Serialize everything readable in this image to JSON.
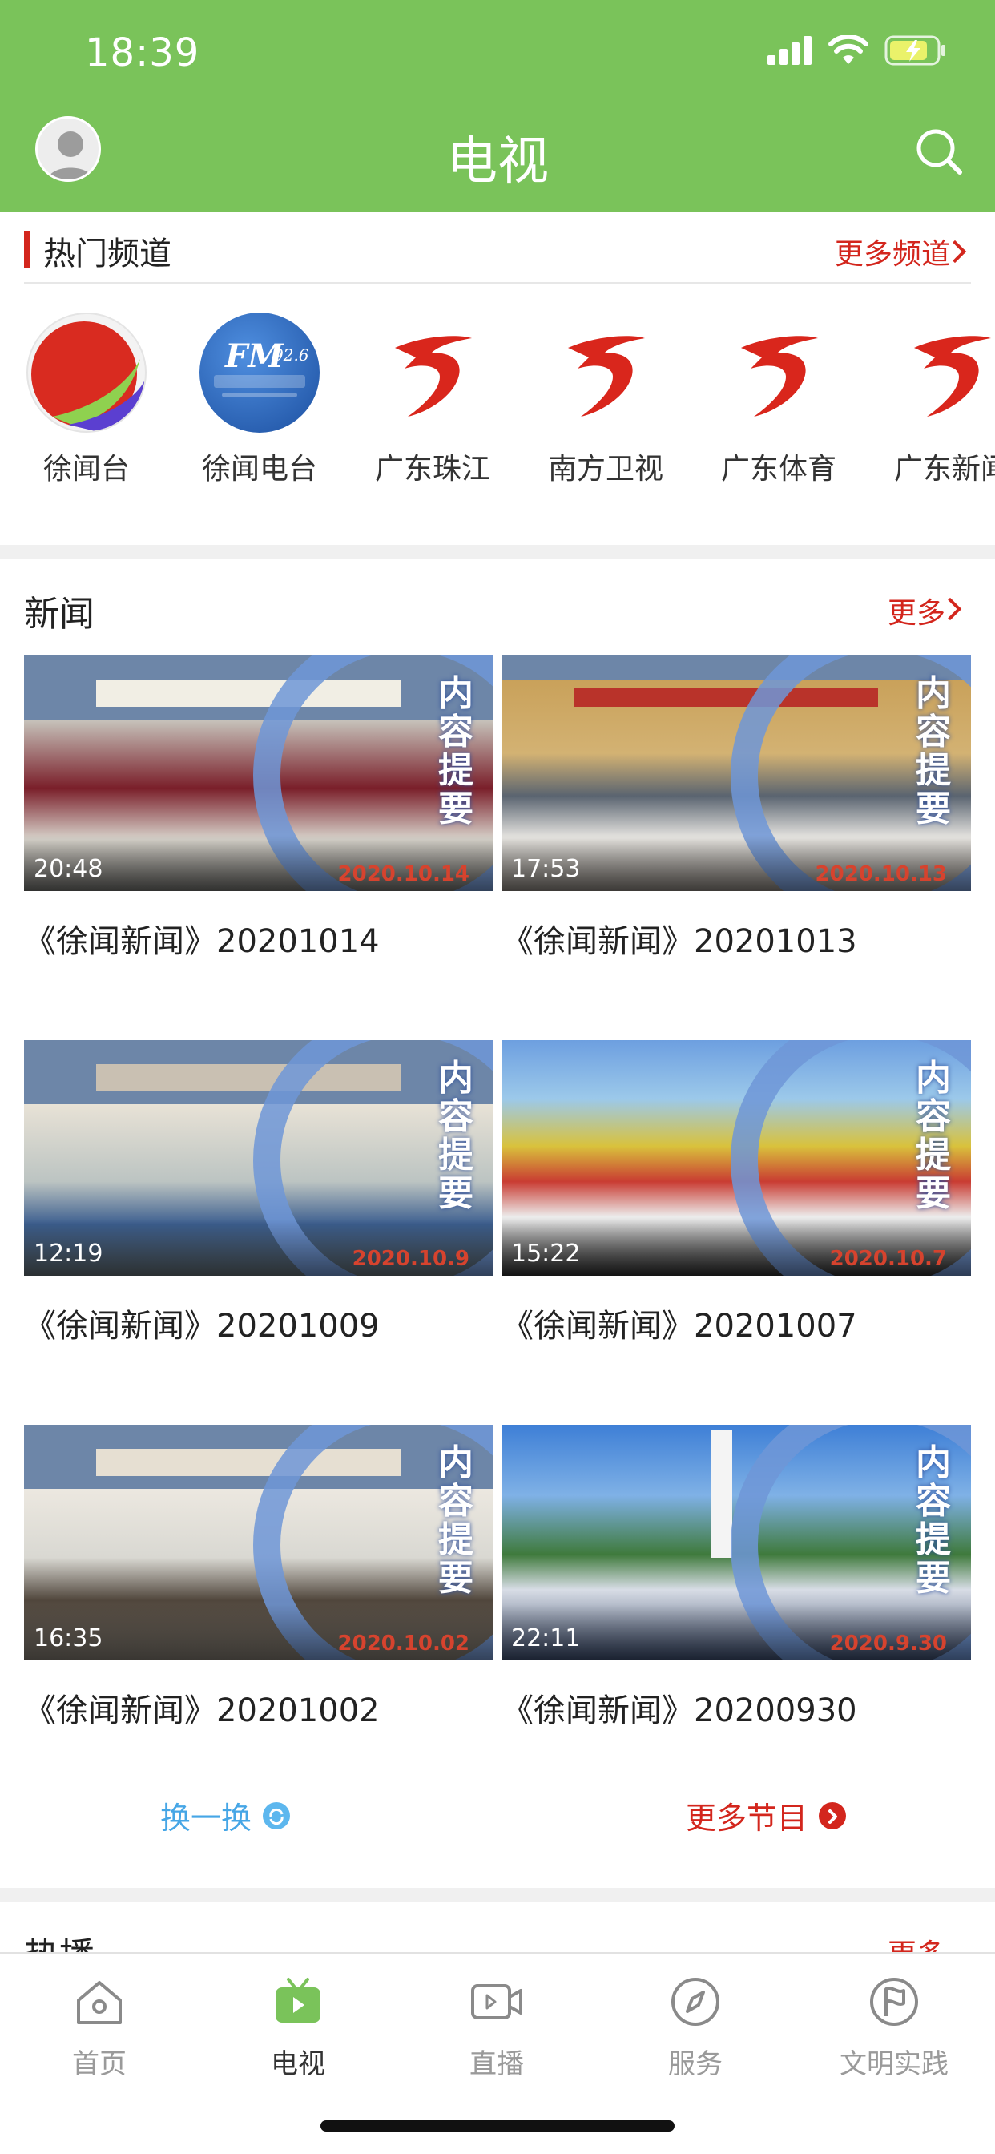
{
  "status_bar": {
    "time": "18:39"
  },
  "header": {
    "title": "电视"
  },
  "hot_channels": {
    "title": "热门频道",
    "more_label": "更多频道",
    "items": [
      {
        "name": "徐闻台",
        "logo": "xuwen-tv-logo"
      },
      {
        "name": "徐闻电台",
        "logo": "xuwen-radio-logo"
      },
      {
        "name": "广东珠江",
        "logo": "gdtv-logo"
      },
      {
        "name": "南方卫视",
        "logo": "gdtv-logo"
      },
      {
        "name": "广东体育",
        "logo": "gdtv-logo"
      },
      {
        "name": "广东新闻",
        "logo": "gdtv-logo"
      }
    ]
  },
  "news": {
    "title": "新闻",
    "more_label": "更多",
    "thumb_overlay_text": "内容提要",
    "items": [
      {
        "title": "《徐闻新闻》20201014",
        "duration": "20:48",
        "date": "2020.10.14"
      },
      {
        "title": "《徐闻新闻》20201013",
        "duration": "17:53",
        "date": "2020.10.13"
      },
      {
        "title": "《徐闻新闻》20201009",
        "duration": "12:19",
        "date": "2020.10.9"
      },
      {
        "title": "《徐闻新闻》20201007",
        "duration": "15:22",
        "date": "2020.10.7"
      },
      {
        "title": "《徐闻新闻》20201002",
        "duration": "16:35",
        "date": "2020.10.02"
      },
      {
        "title": "《徐闻新闻》20200930",
        "duration": "22:11",
        "date": "2020.9.30"
      }
    ],
    "swap_label": "换一换",
    "more_programs_label": "更多节目"
  },
  "hot_play": {
    "title": "热播",
    "more_label": "更多"
  },
  "tabbar": {
    "items": [
      {
        "label": "首页",
        "icon": "home-icon"
      },
      {
        "label": "电视",
        "icon": "tv-icon",
        "active": true
      },
      {
        "label": "直播",
        "icon": "video-camera-icon"
      },
      {
        "label": "服务",
        "icon": "compass-icon"
      },
      {
        "label": "文明实践",
        "icon": "flag-circle-icon"
      }
    ]
  },
  "colors": {
    "accent_green": "#7ac35a",
    "accent_red": "#d3261d",
    "link_blue": "#46a6e6"
  }
}
